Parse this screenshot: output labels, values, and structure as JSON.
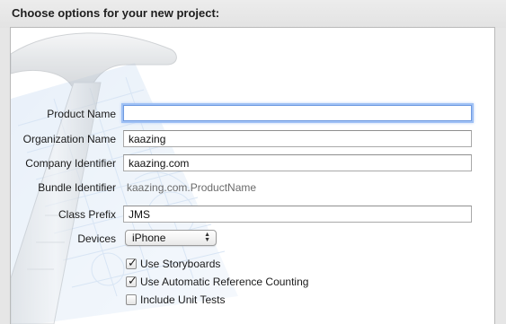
{
  "header": {
    "title": "Choose options for your new project:"
  },
  "form": {
    "product_name": {
      "label": "Product Name",
      "value": ""
    },
    "organization_name": {
      "label": "Organization Name",
      "value": "kaazing"
    },
    "company_identifier": {
      "label": "Company Identifier",
      "value": "kaazing.com"
    },
    "bundle_identifier": {
      "label": "Bundle Identifier",
      "value": "kaazing.com.ProductName"
    },
    "class_prefix": {
      "label": "Class Prefix",
      "value": "JMS"
    },
    "devices": {
      "label": "Devices",
      "selected": "iPhone"
    },
    "checkboxes": [
      {
        "label": "Use Storyboards",
        "checked": true
      },
      {
        "label": "Use Automatic Reference Counting",
        "checked": true
      },
      {
        "label": "Include Unit Tests",
        "checked": false
      }
    ]
  },
  "icons": {
    "background_art": "hammer-blueprint-icon",
    "select_arrows": "up-down-arrows-icon",
    "check": "checkmark-icon"
  },
  "colors": {
    "focus_ring": "#9ec0f5",
    "secondary_text": "#6b6b6b"
  }
}
